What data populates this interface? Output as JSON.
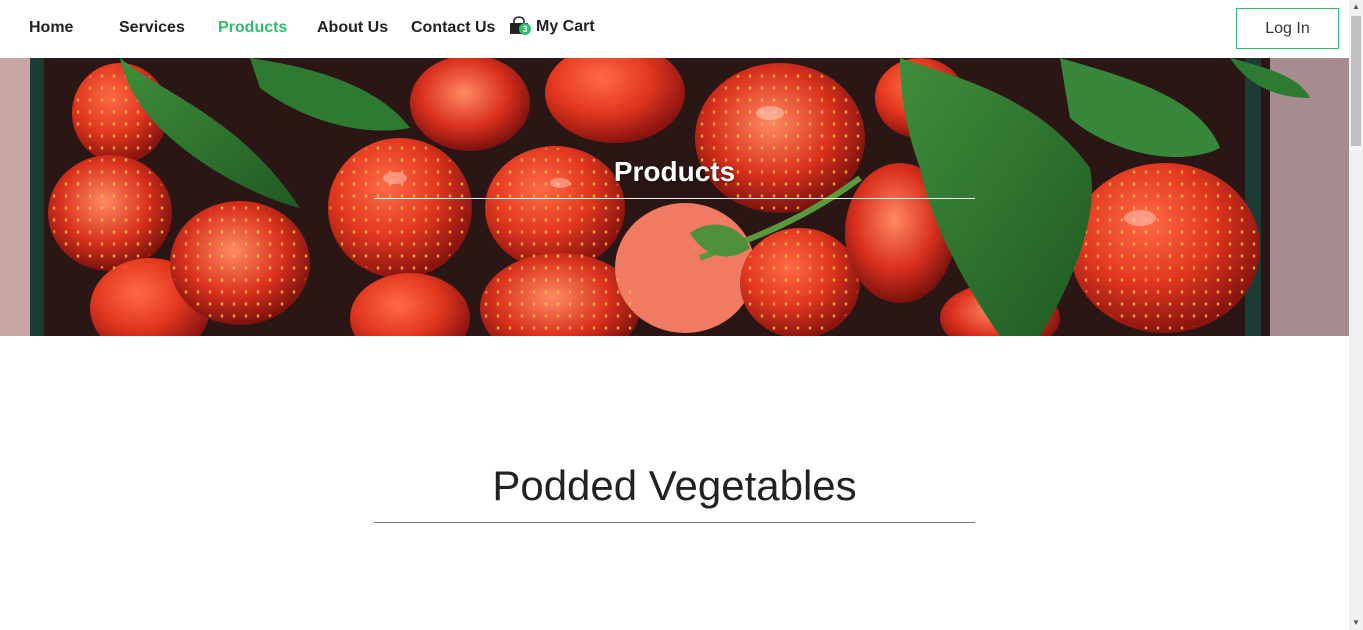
{
  "nav": {
    "home": "Home",
    "services": "Services",
    "products": "Products",
    "about": "About Us",
    "contact": "Contact Us",
    "cart_label": "My Cart",
    "cart_count": "3",
    "cart_icon": "shopping-bag-icon",
    "login_label": "Log In"
  },
  "hero": {
    "title": "Products",
    "image": "strawberries-photo"
  },
  "section": {
    "title": "Podded Vegetables"
  },
  "colors": {
    "accent": "#2ebd6b",
    "text": "#222222"
  }
}
